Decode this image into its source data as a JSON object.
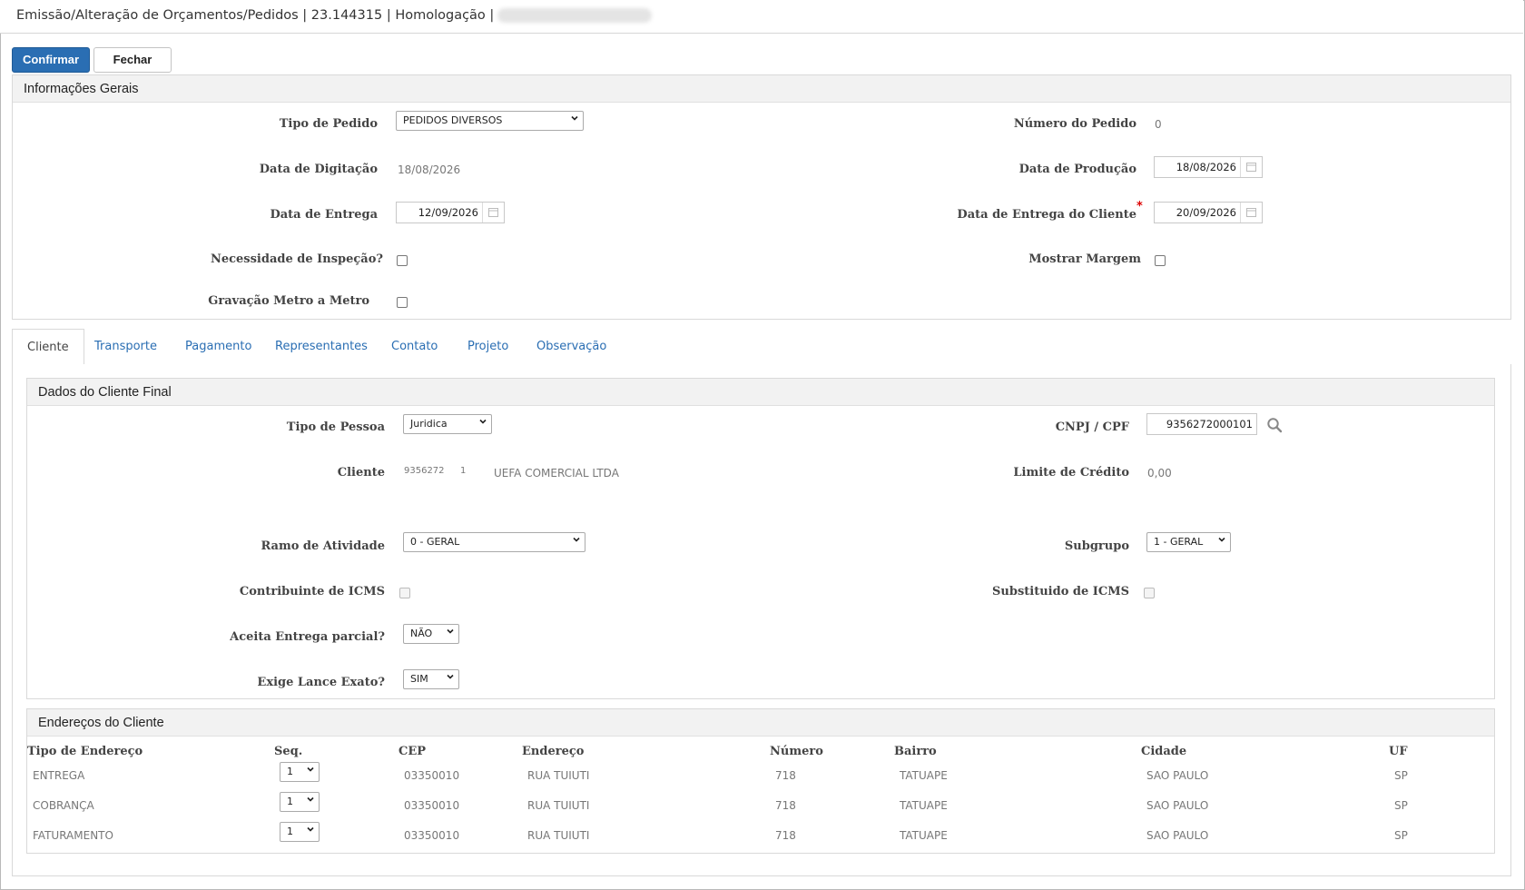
{
  "window": {
    "title": "Emissão/Alteração de Orçamentos/Pedidos | 23.144315 | Homologação |"
  },
  "toolbar": {
    "confirm_label": "Confirmar",
    "close_label": "Fechar"
  },
  "general": {
    "heading": "Informações Gerais",
    "tipo_pedido_label": "Tipo de Pedido",
    "tipo_pedido_value": "PEDIDOS DIVERSOS",
    "numero_pedido_label": "Número do Pedido",
    "numero_pedido_value": "0",
    "data_digitacao_label": "Data de Digitação",
    "data_digitacao_value": "18/08/2026",
    "data_producao_label": "Data de Produção",
    "data_producao_value": "18/08/2026",
    "data_entrega_label": "Data de Entrega",
    "data_entrega_value": "12/09/2026",
    "data_entrega_cliente_label": "Data de Entrega do Cliente",
    "data_entrega_cliente_value": "20/09/2026",
    "required_mark": "*",
    "inspecao_label": "Necessidade de Inspeção?",
    "mostrar_margem_label": "Mostrar Margem",
    "gravacao_label": "Gravação Metro a Metro"
  },
  "tabs": [
    "Cliente",
    "Transporte",
    "Pagamento",
    "Representantes",
    "Contato",
    "Projeto",
    "Observação"
  ],
  "client": {
    "heading": "Dados do Cliente Final",
    "tipo_pessoa_label": "Tipo de Pessoa",
    "tipo_pessoa_value": "Juridica",
    "cnpj_label": "CNPJ / CPF",
    "cnpj_value": "9356272000101",
    "cliente_label": "Cliente",
    "cliente_code": "9356272",
    "cliente_seq": "1",
    "cliente_name": "UEFA COMERCIAL LTDA",
    "limite_label": "Limite de Crédito",
    "limite_value": "0,00",
    "ramo_label": "Ramo de Atividade",
    "ramo_value": "0 - GERAL",
    "subgrupo_label": "Subgrupo",
    "subgrupo_value": "1 - GERAL",
    "icms_label": "Contribuinte de ICMS",
    "subst_icms_label": "Substituido de ICMS",
    "entrega_parcial_label": "Aceita Entrega parcial?",
    "entrega_parcial_value": "NÃO",
    "lance_exato_label": "Exige Lance Exato?",
    "lance_exato_value": "SIM"
  },
  "addresses": {
    "heading": "Endereços do Cliente",
    "columns": [
      "Tipo de Endereço",
      "Seq.",
      "CEP",
      "Endereço",
      "Número",
      "Bairro",
      "Cidade",
      "UF"
    ],
    "rows": [
      {
        "tipo": "ENTREGA",
        "seq": "1",
        "cep": "03350010",
        "endereco": "RUA TUIUTI",
        "numero": "718",
        "bairro": "TATUAPE",
        "cidade": "SAO PAULO",
        "uf": "SP"
      },
      {
        "tipo": "COBRANÇA",
        "seq": "1",
        "cep": "03350010",
        "endereco": "RUA TUIUTI",
        "numero": "718",
        "bairro": "TATUAPE",
        "cidade": "SAO PAULO",
        "uf": "SP"
      },
      {
        "tipo": "FATURAMENTO",
        "seq": "1",
        "cep": "03350010",
        "endereco": "RUA TUIUTI",
        "numero": "718",
        "bairro": "TATUAPE",
        "cidade": "SAO PAULO",
        "uf": "SP"
      }
    ]
  },
  "icons": {
    "calendar": "calendar-icon",
    "search": "search-icon",
    "dropdown": "chevron-down-icon"
  }
}
